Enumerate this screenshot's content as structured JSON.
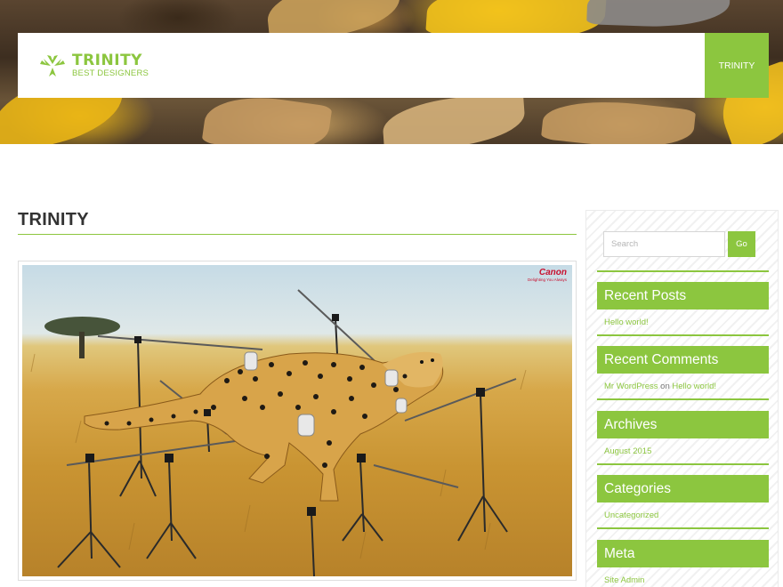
{
  "header": {
    "logo_title": "TRINITY",
    "logo_subtitle": "BEST DESIGNERS",
    "nav": [
      "TRINITY"
    ],
    "accent_color": "#8cc63f"
  },
  "post": {
    "title": "TRINITY",
    "image": {
      "brand": "Canon",
      "tagline": "Delighting You Always"
    }
  },
  "sidebar": {
    "search": {
      "placeholder": "Search",
      "button_label": "Go"
    },
    "widgets": {
      "recent_posts": {
        "title": "Recent Posts",
        "items": [
          "Hello world!"
        ]
      },
      "recent_comments": {
        "title": "Recent Comments",
        "author": "Mr WordPress",
        "on": "on",
        "post": "Hello world!"
      },
      "archives": {
        "title": "Archives",
        "items": [
          "August 2015"
        ]
      },
      "categories": {
        "title": "Categories",
        "items": [
          "Uncategorized"
        ]
      },
      "meta": {
        "title": "Meta",
        "items": [
          "Site Admin"
        ]
      }
    }
  }
}
